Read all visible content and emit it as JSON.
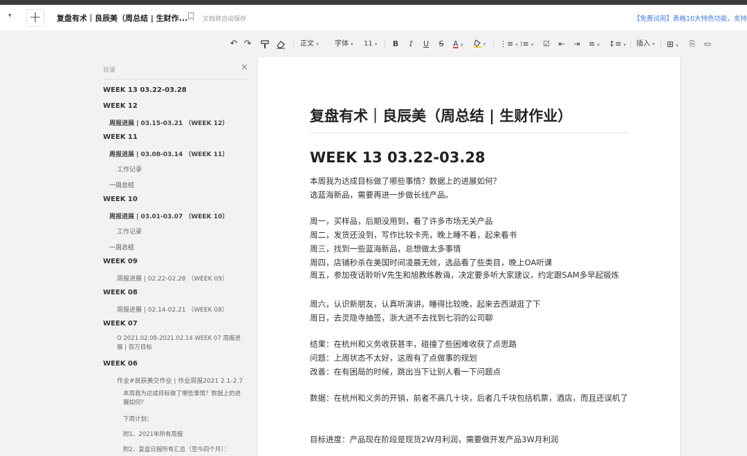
{
  "titlebar": {
    "dropdown_caret": "▾",
    "new_tab": "+",
    "doc_title": "复盘有术｜良辰美（周总结 | 生财作...",
    "autosave": "文档将自动保存",
    "promo": "【免费试用】表格10大特色功能，支持"
  },
  "toolbar": {
    "undo": "↶",
    "redo": "↷",
    "format_painter": "format-painter-icon",
    "clear_format": "eraser-icon",
    "style": "正文",
    "font": "字体",
    "size": "11",
    "bold": "B",
    "italic": "I",
    "underline": "U",
    "strike": "S",
    "font_color": "A",
    "highlight": "highlighter-icon",
    "insert": "插入",
    "accent_underline": "#e0433a"
  },
  "toc": {
    "header": "目录",
    "close": "×",
    "items": [
      "WEEK 13 03.22-03.28",
      "WEEK 12",
      "周报进展 | 03.15-03.21 （WEEK 12）",
      "WEEK 11",
      "周报进展 | 03.08-03.14 （WEEK 11）",
      "工作记录",
      "一周总结",
      "WEEK 10",
      "周报进展 | 03.01-03.07 （WEEK 10）",
      "工作记录",
      "一周总结",
      "WEEK 09",
      "周报进展 | 02.22-02.28 （WEEK 09）",
      "WEEK 08",
      "周报进展 | 02.14-02.21 （WEEK 08）",
      "WEEK 07",
      "O 2021.02.08-2021.02.14 WEEK 07 周报进展 | 百万目标",
      "WEEK 06",
      "作业#良辰美交作业 | 作业周报2021 2.1-2.7",
      "本周我为达成目标做了哪些事情？数据上的进展如何？",
      "下周计划：",
      "附1、2021年所有周报",
      "附2、复盘日报所有汇总（至今四个月）："
    ]
  },
  "doc": {
    "title": "复盘有术｜良辰美（周总结 | 生财作业）",
    "week_heading": "WEEK 13 03.22-03.28",
    "p1": "本周我为达成目标做了哪些事情？数据上的进展如何？",
    "p2": "选蓝海新品，需要再进一步做长线产品。",
    "mon": "周一，买样品，后期没用到，看了许多市场无关产品",
    "tue": "周二，发货还没到，写作比较卡壳，晚上睡不着，起来看书",
    "wed": "周三，找到一些蓝海新品，总想做太多事情",
    "thu": "周四，店铺秒杀在美国时间凌晨无效，选品看了些类目，晚上OA听课",
    "fri": "周五，参加夜话聆听V先生和旭教练教诲，决定要多听大家建议，约定跟SAM多早起锻炼",
    "sat": "周六，认识新朋友，认真听演讲。睡得比较晚，起来去西湖逛了下",
    "sun": "周日，去灵隐寺抽签，浙大进不去找到七羽的公司聊",
    "result": "结果：在杭州和义务收获甚丰，碰撞了些困难收获了点思路",
    "problem": "问题：上周状态不太好，这周有了点做事的规划",
    "improve": "改善：在有困局的时候，跳出当下让别人看一下问题点",
    "data": "数据：在杭州和义务的开销，前者不高几十块，后者几千块包括机票，酒店，而且还误机了",
    "target": "目标进度：产品现在阶段是现货2W月利润，需要做开发产品3W月利润"
  }
}
